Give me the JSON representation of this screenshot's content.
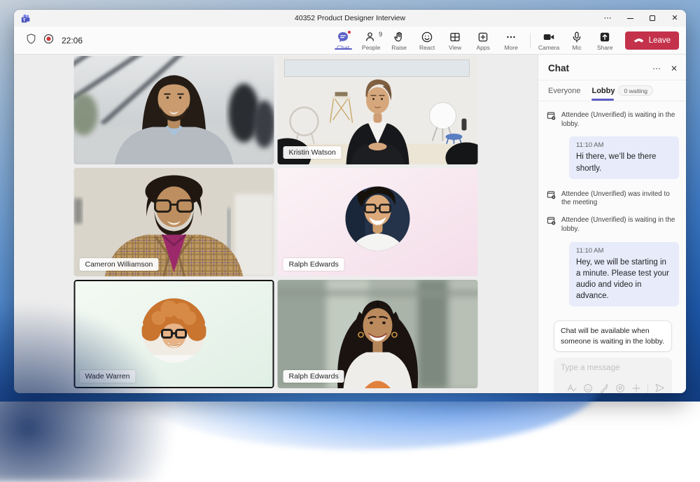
{
  "titlebar": {
    "title": "40352 Product Designer Interview",
    "more_glyph": "⋯",
    "close_glyph": "✕"
  },
  "toolbar": {
    "timer": "22:06",
    "nav": [
      {
        "label": "Chat",
        "active": true,
        "notification": true
      },
      {
        "label": "People",
        "count": "9"
      },
      {
        "label": "Raise"
      },
      {
        "label": "React"
      },
      {
        "label": "View"
      },
      {
        "label": "Apps"
      },
      {
        "label": "More"
      }
    ],
    "devices": [
      {
        "label": "Camera"
      },
      {
        "label": "Mic"
      },
      {
        "label": "Share"
      }
    ],
    "leave_label": "Leave"
  },
  "stage": {
    "participants": [
      {
        "kind": "video",
        "name": ""
      },
      {
        "kind": "video",
        "name": "Kristin Watson"
      },
      {
        "kind": "video",
        "name": "Cameron Williamson"
      },
      {
        "kind": "avatar",
        "name": "Ralph Edwards"
      },
      {
        "kind": "avatar",
        "name": "Wade Warren",
        "speaking": true
      },
      {
        "kind": "video",
        "name": "Ralph Edwards"
      }
    ]
  },
  "chat": {
    "title": "Chat",
    "menu_glyph": "⋯",
    "close_glyph": "✕",
    "tabs": [
      {
        "label": "Everyone"
      },
      {
        "label": "Lobby",
        "badge": "0 waiting",
        "active": true
      }
    ],
    "feed": [
      {
        "type": "event",
        "text": "Attendee (Unverified) is waiting in the lobby."
      },
      {
        "type": "message",
        "time": "11:10 AM",
        "text": "Hi there, we’ll be there shortly."
      },
      {
        "type": "event",
        "text": "Attendee (Unverified) was invited to the meeting"
      },
      {
        "type": "event",
        "text": "Attendee (Unverified) is waiting in the lobby."
      },
      {
        "type": "message",
        "time": "11:10 AM",
        "text": "Hey, we will be starting in a minute. Please test your audio and video in advance."
      }
    ],
    "notice": "Chat will be available when someone is waiting in the lobby.",
    "compose_placeholder": "Type a message"
  },
  "colors": {
    "accent": "#5b5fc7",
    "leave": "#c4314b",
    "record": "#d13438",
    "bubble": "#e7ebfa"
  }
}
